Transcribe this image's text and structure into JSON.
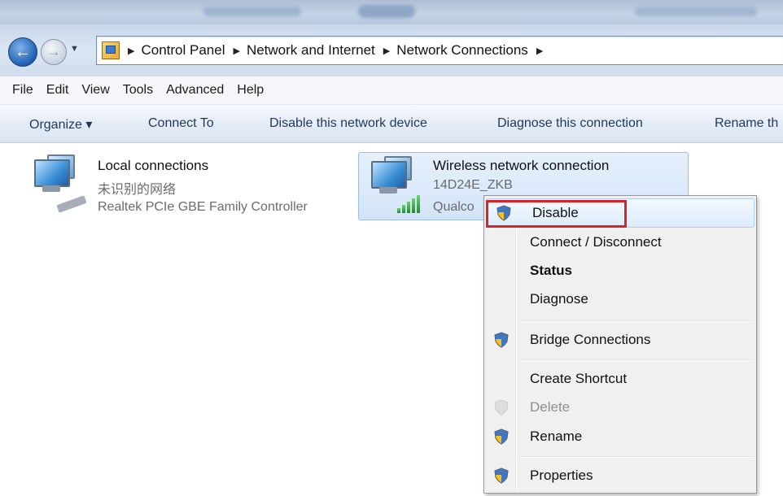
{
  "breadcrumb": {
    "items": [
      "Control Panel",
      "Network and Internet",
      "Network Connections"
    ]
  },
  "menubar": {
    "items": [
      "File",
      "Edit",
      "View",
      "Tools",
      "Advanced",
      "Help"
    ]
  },
  "commandbar": {
    "organize": "Organize ▾",
    "connect_to": "Connect To",
    "disable_device": "Disable this network device",
    "diagnose": "Diagnose this connection",
    "rename": "Rename th"
  },
  "connections": {
    "local": {
      "name": "Local connections",
      "status": "未识别的网络",
      "adapter": "Realtek PCIe GBE Family Controller"
    },
    "wireless": {
      "name": "Wireless network connection",
      "status": "14D24E_ZKB",
      "adapter": "Qualco"
    }
  },
  "context_menu": {
    "items": [
      {
        "label": "Disable",
        "icon": "uac-shield-icon"
      },
      {
        "label": "Connect / Disconnect"
      },
      {
        "label": "Status",
        "bold": true
      },
      {
        "label": "Diagnose"
      },
      {
        "label": "Bridge Connections",
        "icon": "uac-shield-icon"
      },
      {
        "label": "Create Shortcut"
      },
      {
        "label": "Delete",
        "icon": "uac-shield-icon",
        "disabled": true
      },
      {
        "label": "Rename",
        "icon": "uac-shield-icon"
      },
      {
        "label": "Properties",
        "icon": "uac-shield-icon"
      }
    ]
  },
  "colors": {
    "highlight_box": "#d8232a",
    "selection": "#d3e4f8"
  }
}
